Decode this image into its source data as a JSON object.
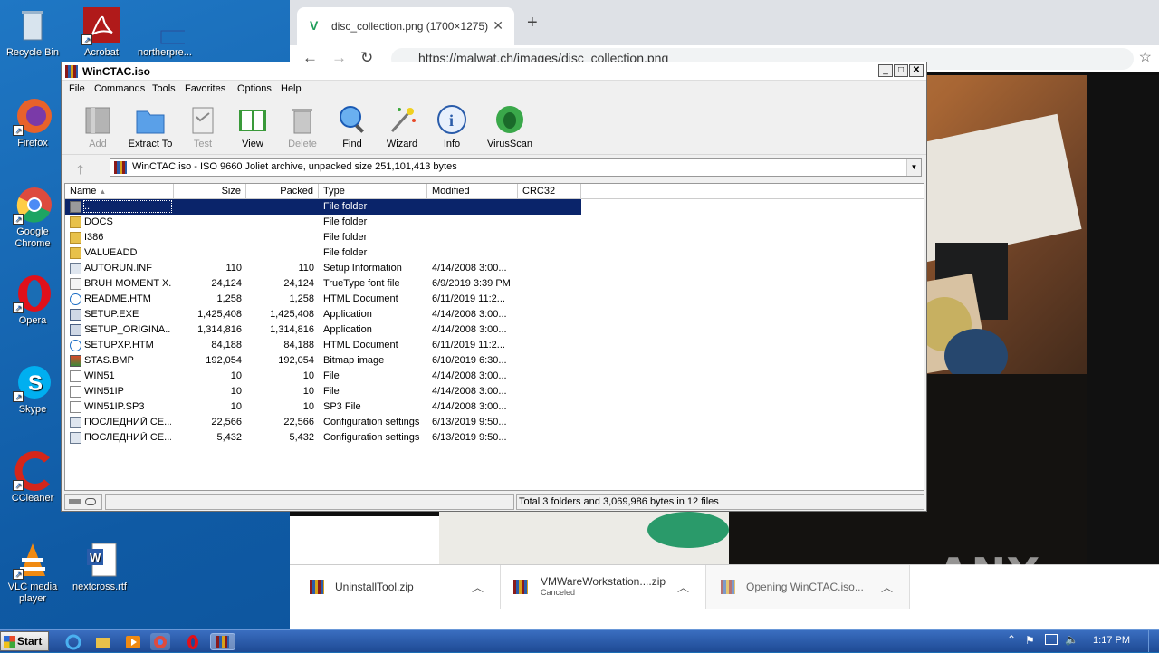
{
  "desktop": {
    "icons": [
      {
        "label": "Recycle Bin"
      },
      {
        "label": "Acrobat"
      },
      {
        "label": "northerpre..."
      },
      {
        "label": "Firefox"
      },
      {
        "label": "Google Chrome"
      },
      {
        "label": "Opera"
      },
      {
        "label": "Skype"
      },
      {
        "label": "CCleaner"
      },
      {
        "label": "VLC media player"
      },
      {
        "label": "nextcross.rtf"
      }
    ]
  },
  "browser": {
    "tab_title": "disc_collection.png (1700×1275)",
    "url": "https://malwat.ch/images/disc_collection.png",
    "downloads": [
      {
        "name": "UninstallTool.zip",
        "status": ""
      },
      {
        "name": "VMWareWorkstation....zip",
        "status": "Canceled"
      },
      {
        "name": "Opening WinCTAC.iso...",
        "status": ""
      }
    ],
    "watermark": "ANY RUN"
  },
  "winrar": {
    "title": "WinCTAC.iso",
    "menu": [
      "File",
      "Commands",
      "Tools",
      "Favorites",
      "Options",
      "Help"
    ],
    "toolbar": [
      {
        "label": "Add",
        "enabled": false
      },
      {
        "label": "Extract To",
        "enabled": true
      },
      {
        "label": "Test",
        "enabled": false
      },
      {
        "label": "View",
        "enabled": true
      },
      {
        "label": "Delete",
        "enabled": false
      },
      {
        "label": "Find",
        "enabled": true
      },
      {
        "label": "Wizard",
        "enabled": true
      },
      {
        "label": "Info",
        "enabled": true
      },
      {
        "label": "VirusScan",
        "enabled": true
      }
    ],
    "path": "WinCTAC.iso - ISO 9660 Joliet archive, unpacked size 251,101,413 bytes",
    "columns": [
      "Name",
      "Size",
      "Packed",
      "Type",
      "Modified",
      "CRC32"
    ],
    "rows": [
      {
        "name": "..",
        "size": "",
        "packed": "",
        "type": "File folder",
        "modified": "",
        "icon": "up"
      },
      {
        "name": "DOCS",
        "size": "",
        "packed": "",
        "type": "File folder",
        "modified": "",
        "icon": "folder"
      },
      {
        "name": "I386",
        "size": "",
        "packed": "",
        "type": "File folder",
        "modified": "",
        "icon": "folder"
      },
      {
        "name": "VALUEADD",
        "size": "",
        "packed": "",
        "type": "File folder",
        "modified": "",
        "icon": "folder"
      },
      {
        "name": "AUTORUN.INF",
        "size": "110",
        "packed": "110",
        "type": "Setup Information",
        "modified": "4/14/2008 3:00...",
        "icon": "set"
      },
      {
        "name": "BRUH MOMENT X...",
        "size": "24,124",
        "packed": "24,124",
        "type": "TrueType font file",
        "modified": "6/9/2019 3:39 PM",
        "icon": "font"
      },
      {
        "name": "README.HTM",
        "size": "1,258",
        "packed": "1,258",
        "type": "HTML Document",
        "modified": "6/11/2019 11:2...",
        "icon": "ie"
      },
      {
        "name": "SETUP.EXE",
        "size": "1,425,408",
        "packed": "1,425,408",
        "type": "Application",
        "modified": "4/14/2008 3:00...",
        "icon": "exe"
      },
      {
        "name": "SETUP_ORIGINA...",
        "size": "1,314,816",
        "packed": "1,314,816",
        "type": "Application",
        "modified": "4/14/2008 3:00...",
        "icon": "exe"
      },
      {
        "name": "SETUPXP.HTM",
        "size": "84,188",
        "packed": "84,188",
        "type": "HTML Document",
        "modified": "6/11/2019 11:2...",
        "icon": "ie"
      },
      {
        "name": "STAS.BMP",
        "size": "192,054",
        "packed": "192,054",
        "type": "Bitmap image",
        "modified": "6/10/2019 6:30...",
        "icon": "bmp"
      },
      {
        "name": "WIN51",
        "size": "10",
        "packed": "10",
        "type": "File",
        "modified": "4/14/2008 3:00...",
        "icon": "file"
      },
      {
        "name": "WIN51IP",
        "size": "10",
        "packed": "10",
        "type": "File",
        "modified": "4/14/2008 3:00...",
        "icon": "file"
      },
      {
        "name": "WIN51IP.SP3",
        "size": "10",
        "packed": "10",
        "type": "SP3 File",
        "modified": "4/14/2008 3:00...",
        "icon": "file"
      },
      {
        "name": "ПОСЛЕДНИЙ СЕ...",
        "size": "22,566",
        "packed": "22,566",
        "type": "Configuration settings",
        "modified": "6/13/2019 9:50...",
        "icon": "set"
      },
      {
        "name": "ПОСЛЕДНИЙ СЕ...",
        "size": "5,432",
        "packed": "5,432",
        "type": "Configuration settings",
        "modified": "6/13/2019 9:50...",
        "icon": "set"
      }
    ],
    "status": "Total 3 folders and 3,069,986 bytes in 12 files"
  },
  "taskbar": {
    "start_label": "Start",
    "clock": "1:17 PM"
  }
}
